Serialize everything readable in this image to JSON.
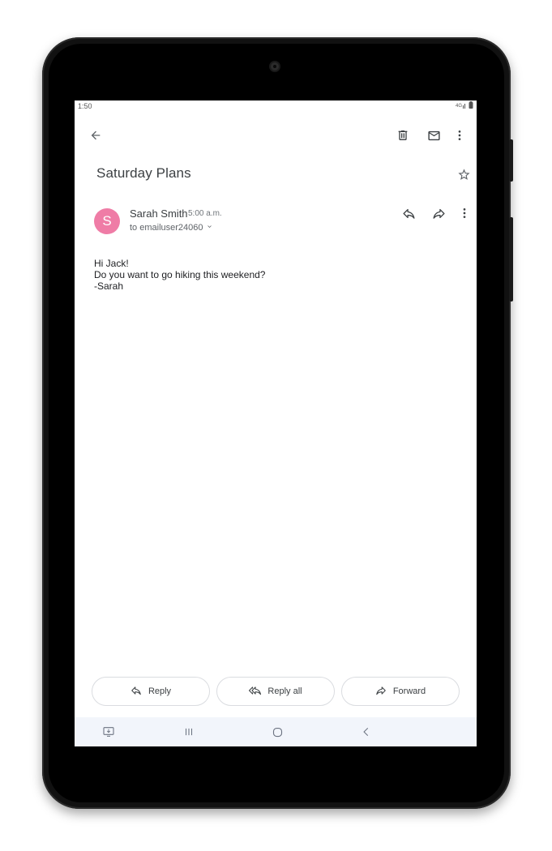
{
  "status_bar": {
    "time": "1:50"
  },
  "toolbar": {
    "back_icon": "arrow-back-icon",
    "delete_icon": "trash-icon",
    "mark_unread_icon": "mail-icon",
    "more_icon": "more-vert-icon"
  },
  "email": {
    "subject": "Saturday Plans",
    "star_icon": "star-outline-icon",
    "sender": {
      "initial": "S",
      "name": "Sarah Smith",
      "time": "5:00 a.m.",
      "recipient": "to emailuser24060",
      "avatar_color": "#ef7ca6"
    },
    "header_actions": [
      "reply-icon",
      "forward-icon",
      "more-vert-icon"
    ],
    "body_lines": [
      "Hi Jack!",
      "Do you want to go hiking this weekend?",
      "-Sarah"
    ]
  },
  "actions": {
    "reply": "Reply",
    "reply_all": "Reply all",
    "forward": "Forward"
  },
  "nav_bar": {
    "items": [
      "screen-icon",
      "recents-icon",
      "home-icon",
      "back-icon"
    ],
    "background": "#f2f5fb"
  }
}
